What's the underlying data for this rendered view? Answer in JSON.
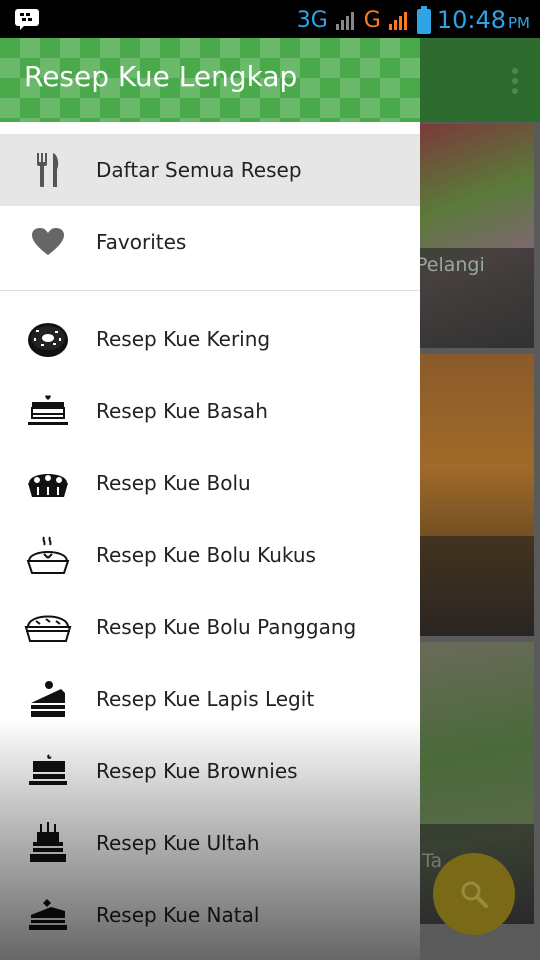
{
  "status_bar": {
    "network1": "3G",
    "network2": "G",
    "time": "10:48",
    "ampm": "PM"
  },
  "drawer": {
    "title": "Resep Kue Lengkap",
    "primary_items": [
      {
        "label": "Daftar Semua Resep",
        "icon": "fork-knife-icon",
        "active": true
      },
      {
        "label": "Favorites",
        "icon": "heart-icon",
        "active": false
      }
    ],
    "category_items": [
      {
        "label": "Resep Kue Kering",
        "icon": "donut-icon"
      },
      {
        "label": "Resep Kue Basah",
        "icon": "cake-icon"
      },
      {
        "label": "Resep Kue Bolu",
        "icon": "pie-icon"
      },
      {
        "label": "Resep Kue Bolu Kukus",
        "icon": "steamed-pie-icon"
      },
      {
        "label": "Resep Kue Bolu Panggang",
        "icon": "baked-pie-icon"
      },
      {
        "label": "Resep Kue Lapis Legit",
        "icon": "cake-slice-icon"
      },
      {
        "label": "Resep Kue Brownies",
        "icon": "brownie-icon"
      },
      {
        "label": "Resep Kue Ultah",
        "icon": "birthday-cake-icon"
      },
      {
        "label": "Resep Kue Natal",
        "icon": "christmas-cake-icon"
      }
    ]
  },
  "background": {
    "card1_caption": "Pelangi",
    "card3_caption": "Ta"
  },
  "colors": {
    "header_green": "#4aa94a",
    "status_blue": "#2fa3e6",
    "status_orange": "#ff7a1a"
  }
}
